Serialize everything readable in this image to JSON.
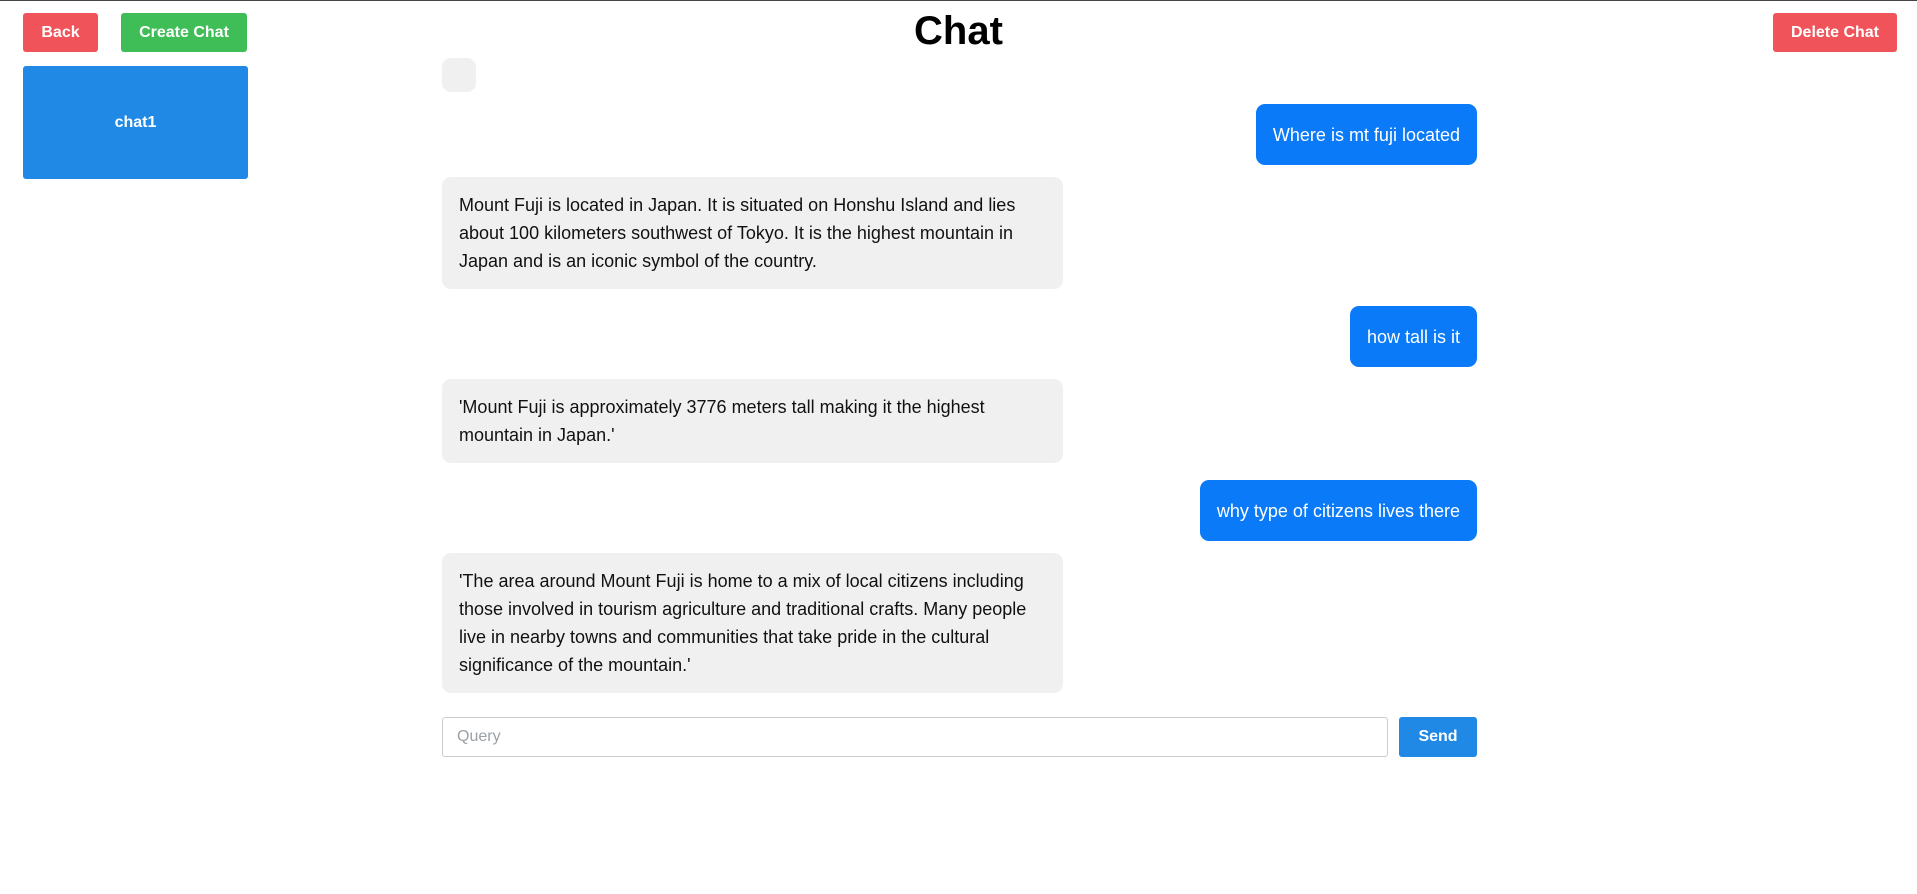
{
  "header": {
    "title": "Chat",
    "back_label": "Back",
    "create_label": "Create Chat",
    "delete_label": "Delete Chat"
  },
  "sidebar": {
    "chats": [
      {
        "label": "chat1"
      }
    ]
  },
  "messages": [
    {
      "role": "user",
      "text": "Where is mt fuji located"
    },
    {
      "role": "assistant",
      "text": "Mount Fuji is located in Japan. It is situated on Honshu Island and lies about 100 kilometers southwest of Tokyo. It is the highest mountain in Japan and is an iconic symbol of the country."
    },
    {
      "role": "user",
      "text": "how tall is it"
    },
    {
      "role": "assistant",
      "text": "'Mount Fuji is approximately 3776 meters tall making it the highest mountain in Japan.'"
    },
    {
      "role": "user",
      "text": "why type of citizens lives there"
    },
    {
      "role": "assistant",
      "text": "'The area around Mount Fuji is home to a mix of local citizens including those involved in tourism agriculture and traditional crafts. Many people live in nearby towns and communities that take pride in the cultural significance of the mountain.'"
    }
  ],
  "composer": {
    "value": "",
    "placeholder": "Query",
    "send_label": "Send"
  },
  "colors": {
    "danger": "#f0545a",
    "success": "#3fbe57",
    "primary": "#1f89e5",
    "user_bubble": "#0a7af9",
    "bot_bubble": "#f0f0f0"
  }
}
